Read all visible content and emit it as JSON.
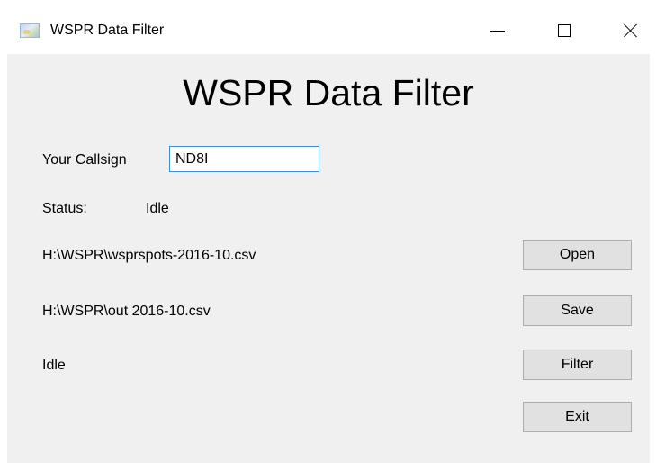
{
  "window": {
    "title": "WSPR Data Filter",
    "icon": "app-icon"
  },
  "main": {
    "heading": "WSPR Data Filter",
    "callsign_label": "Your Callsign",
    "callsign_value": "ND8I",
    "status_label": "Status:",
    "status_value": "Idle",
    "input_path": "H:\\WSPR\\wsprspots-2016-10.csv",
    "output_path": "H:\\WSPR\\out 2016-10.csv",
    "progress_text": "Idle"
  },
  "buttons": {
    "open": "Open",
    "save": "Save",
    "filter": "Filter",
    "exit": "Exit"
  },
  "colors": {
    "client_background": "#f0f0f0",
    "button_face": "#e1e1e1",
    "input_focus_border": "#3c8fd6"
  }
}
